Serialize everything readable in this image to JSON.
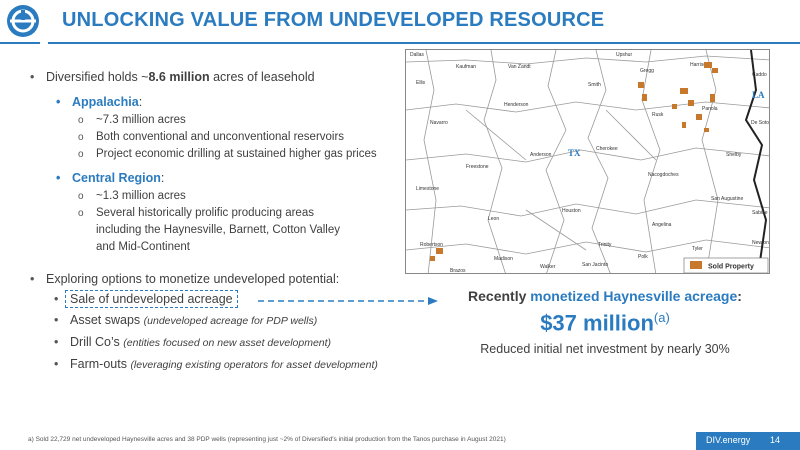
{
  "header": {
    "title": "UNLOCKING VALUE FROM UNDEVELOPED RESOURCE",
    "accent_color": "#2a7bbf",
    "logo_icon": "diversified-logo-icon"
  },
  "left": {
    "intro_prefix": "Diversified holds ~",
    "intro_bold": "8.6 million",
    "intro_suffix": " acres of leasehold",
    "appalachia": {
      "label": "Appalachia",
      "items": [
        "~7.3 million acres",
        "Both conventional and unconventional reservoirs",
        "Project economic drilling at sustained higher gas prices"
      ]
    },
    "central": {
      "label": "Central Region",
      "items": [
        "~1.3 million acres",
        "Several historically prolific producing areas including the Haynesville, Barnett, Cotton Valley and Mid-Continent"
      ]
    },
    "explore": "Exploring options to monetize undeveloped potential:",
    "options": [
      {
        "text": "Sale of undeveloped acreage",
        "note": ""
      },
      {
        "text": "Asset swaps",
        "note": "(undeveloped acreage for PDP wells)"
      },
      {
        "text": "Drill Co’s",
        "note": "(entities focused on new asset development)"
      },
      {
        "text": "Farm-outs",
        "note": "(leveraging existing operators for asset development)"
      }
    ]
  },
  "map": {
    "counties": [
      "Dallas",
      "Kaufman",
      "Van Zandt",
      "Upshur",
      "Harrison",
      "Caddo",
      "Gregg",
      "Smith",
      "Ellis",
      "Henderson",
      "Rusk",
      "Panola",
      "De Soto",
      "Navarro",
      "Anderson",
      "Cherokee",
      "Shelby",
      "Freestone",
      "Nacogdoches",
      "Limestone",
      "San Augustine",
      "Leon",
      "Houston",
      "Sabine",
      "Angelina",
      "Robertson",
      "Trinity",
      "Newton",
      "Brazos",
      "Madison",
      "Walker",
      "San Jacinto",
      "Polk",
      "Tyler"
    ],
    "state_tx": "TX",
    "state_la": "LA",
    "legend_label": "Sold Property",
    "property_color": "#c8782a"
  },
  "right": {
    "head_prefix": "Recently ",
    "head_highlight": "monetized Haynesville acreage",
    "head_suffix": ":",
    "value": "$37 million",
    "value_note": "(a)",
    "note": "Reduced initial net investment by nearly 30%"
  },
  "footer": {
    "footnote": "a)  Sold 22,729 net undeveloped Haynesville acres and 38 PDP wells (representing just ~2% of Diversified's initial production from the Tanos purchase in August 2021)",
    "brand": "DIV.energy",
    "page": "14"
  }
}
